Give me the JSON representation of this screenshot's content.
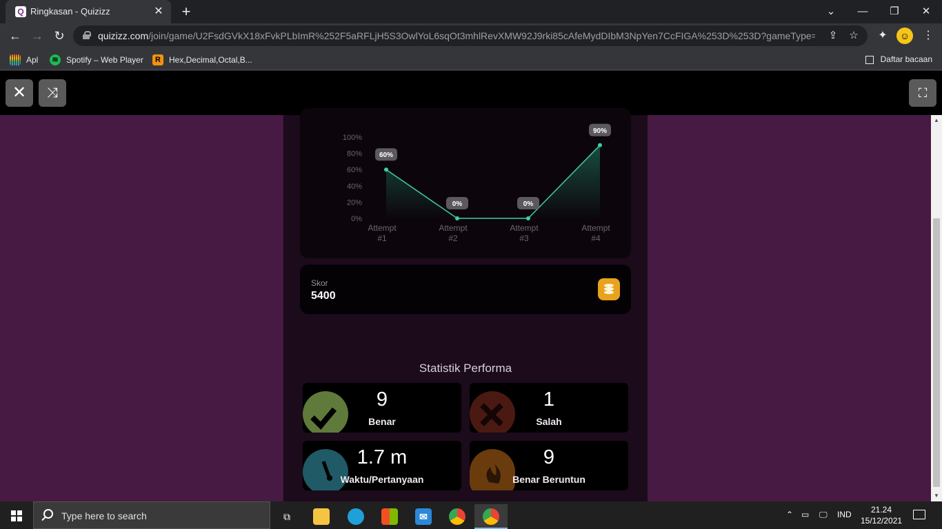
{
  "browser": {
    "tab_title": "Ringkasan - Quizizz",
    "tab_favicon": "Q",
    "url_host": "quizizz.com",
    "url_path": "/join/game/U2FsdGVkX18xFvkPLbImR%252F5aRFLjH5S3OwlYoL6sqOt3mhlRevXMW92J9rki85cAfeMydDIbM3NpYen7CcFIGA%253D%253D?gameType=async",
    "bookmarks": [
      {
        "label": "Apl",
        "icon": "apps-grid-icon"
      },
      {
        "label": "Spotify – Web Player",
        "icon": "spotify-icon"
      },
      {
        "label": "Hex,Decimal,Octal,B...",
        "icon": "r-icon",
        "icon_char": "R"
      }
    ],
    "reading_list": "Daftar bacaan"
  },
  "chart_data": {
    "type": "line",
    "categories": [
      "Attempt #1",
      "Attempt #2",
      "Attempt #3",
      "Attempt #4"
    ],
    "category_lines": [
      [
        "Attempt",
        "#1"
      ],
      [
        "Attempt",
        "#2"
      ],
      [
        "Attempt",
        "#3"
      ],
      [
        "Attempt",
        "#4"
      ]
    ],
    "values": [
      60,
      0,
      0,
      90
    ],
    "data_labels": [
      "60%",
      "0%",
      "0%",
      "90%"
    ],
    "y_ticks": [
      "100%",
      "80%",
      "60%",
      "40%",
      "20%",
      "0%"
    ],
    "ylim": [
      0,
      100
    ],
    "title": "",
    "xlabel": "",
    "ylabel": "",
    "grid": false,
    "line_color": "#3ecf9b"
  },
  "score": {
    "label": "Skor",
    "value": "5400",
    "icon": "coins-icon"
  },
  "stats": {
    "title": "Statistik Performa",
    "items": [
      {
        "value": "9",
        "label": "Benar",
        "icon": "checkmark-icon",
        "color": "#5f7a3a"
      },
      {
        "value": "1",
        "label": "Salah",
        "icon": "cross-icon",
        "color": "#4a1a12"
      },
      {
        "value": "1.7 m",
        "label": "Waktu/Pertanyaan",
        "icon": "stopwatch-icon",
        "color": "#1f5a66"
      },
      {
        "value": "9",
        "label": "Benar Beruntun",
        "icon": "flame-icon",
        "color": "#6a3b0c"
      }
    ]
  },
  "taskbar": {
    "search_placeholder": "Type here to search",
    "language": "IND",
    "time": "21.24",
    "date": "15/12/2021"
  }
}
